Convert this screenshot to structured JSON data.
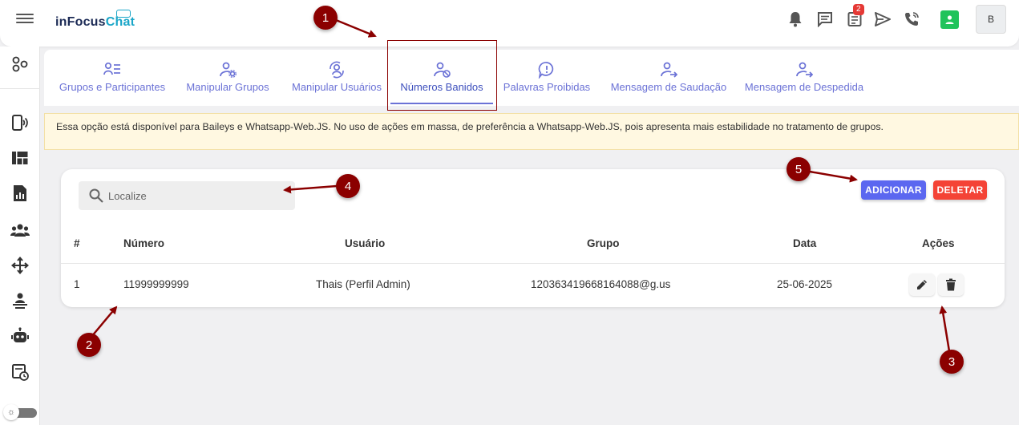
{
  "app": {
    "logo_part1": "inFocus",
    "logo_part2": "Chat",
    "notification_count": "2",
    "avatar_letter": "B"
  },
  "tabs": [
    {
      "label": "Grupos e Participantes",
      "icon": "list-user-icon",
      "active": false
    },
    {
      "label": "Manipular Grupos",
      "icon": "user-gear-icon",
      "active": false
    },
    {
      "label": "Manipular Usuários",
      "icon": "user-sync-icon",
      "active": false
    },
    {
      "label": "Números Banidos",
      "icon": "user-ban-icon",
      "active": true
    },
    {
      "label": "Palavras Proibidas",
      "icon": "chat-alert-icon",
      "active": false
    },
    {
      "label": "Mensagem de Saudação",
      "icon": "user-arrow-icon",
      "active": false
    },
    {
      "label": "Mensagem de Despedida",
      "icon": "user-arrow-icon",
      "active": false
    }
  ],
  "notice": "Essa opção está disponível para Baileys e Whatsapp-Web.JS. No uso de ações em massa, de preferência a Whatsapp-Web.JS, pois apresenta mais estabilidade no tratamento de grupos.",
  "search": {
    "placeholder": "Localize",
    "value": ""
  },
  "buttons": {
    "add": "ADICIONAR",
    "delete": "DELETAR"
  },
  "table": {
    "headers": [
      "#",
      "Número",
      "Usuário",
      "Grupo",
      "Data",
      "Ações"
    ],
    "rows": [
      {
        "index": "1",
        "numero": "11999999999",
        "usuario": "Thais (Perfil Admin)",
        "grupo": "120363419668164088@g.us",
        "data": "25-06-2025"
      }
    ]
  },
  "markers": [
    "1",
    "2",
    "3",
    "4",
    "5"
  ],
  "colors": {
    "accent": "#5b67f0",
    "tab_text": "#6b72d6",
    "danger": "#f44336",
    "marker": "#8b0000",
    "notice_bg": "#fff8e1",
    "online": "#20c35b"
  }
}
